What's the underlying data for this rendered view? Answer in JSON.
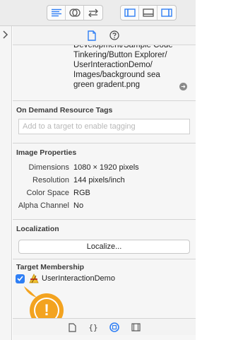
{
  "toolbar": {
    "editor_buttons": [
      "standard-editor-icon",
      "assistant-editor-icon",
      "version-editor-icon"
    ],
    "panel_buttons": [
      "navigator-panel-icon",
      "debug-panel-icon",
      "utilities-panel-icon"
    ]
  },
  "inspector_tabs": [
    "file-inspector-icon",
    "quick-help-icon"
  ],
  "file": {
    "full_path_lines": [
      "Development/Sample Code",
      "Tinkering/Button Explorer/",
      "UserInteractionDemo/",
      "Images/background sea",
      "green gradent.png"
    ]
  },
  "on_demand": {
    "title": "On Demand Resource Tags",
    "tag_placeholder": "Add to a target to enable tagging"
  },
  "image_properties": {
    "title": "Image Properties",
    "rows": [
      {
        "label": "Dimensions",
        "value": "1080 × 1920 pixels"
      },
      {
        "label": "Resolution",
        "value": "144 pixels/inch"
      },
      {
        "label": "Color Space",
        "value": "RGB"
      },
      {
        "label": "Alpha Channel",
        "value": "No"
      }
    ]
  },
  "localization": {
    "title": "Localization",
    "button_label": "Localize..."
  },
  "target_membership": {
    "title": "Target Membership",
    "target_name": "UserInteractionDemo",
    "checked": true,
    "warning_glyph": "!"
  },
  "library_tabs": [
    "file-template-icon",
    "code-snippet-icon",
    "object-library-icon",
    "media-library-icon"
  ],
  "colors": {
    "accent": "#2f7ff5",
    "warning": "#f3a320"
  }
}
